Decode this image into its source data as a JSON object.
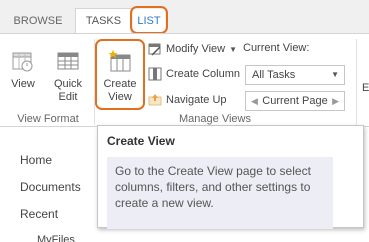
{
  "tabs": {
    "browse": "BROWSE",
    "tasks": "TASKS",
    "list": "LIST"
  },
  "ribbon": {
    "view_format": {
      "view": "View",
      "quick_edit": "Quick\nEdit",
      "label": "View Format"
    },
    "manage_views": {
      "create_view": "Create\nView",
      "modify_view": "Modify View",
      "create_column": "Create Column",
      "navigate_up": "Navigate Up",
      "current_view_label": "Current View:",
      "current_view_value": "All Tasks",
      "current_page": "Current Page",
      "label": "Manage Views"
    },
    "next_group_initial": "E"
  },
  "quick_launch": {
    "items": [
      "Home",
      "Documents",
      "Recent"
    ],
    "sub": "MyFiles"
  },
  "tooltip": {
    "title": "Create View",
    "body": "Go to the Create View page to select columns, filters, and other settings to create a new view."
  },
  "colors": {
    "highlight": "#e07020",
    "link": "#2b7bc9",
    "tooltip_body": "#ededf5"
  }
}
